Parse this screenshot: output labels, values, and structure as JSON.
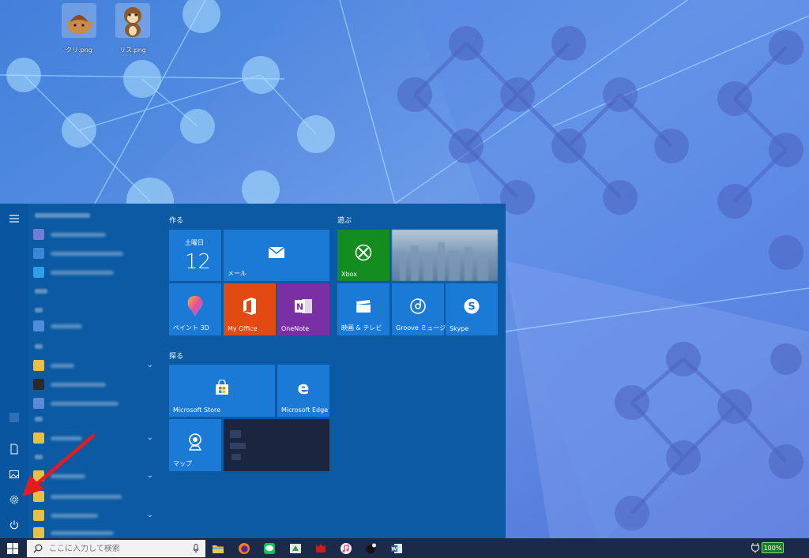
{
  "desktop": {
    "icons": [
      {
        "label": "クリ.png"
      },
      {
        "label": "リス.png"
      }
    ]
  },
  "start_menu": {
    "groups": {
      "create": "作る",
      "play": "遊ぶ",
      "explore": "探る"
    },
    "tiles": {
      "calendar_day": "土曜日",
      "calendar_date": "12",
      "mail": "メール",
      "paint3d": "ペイント 3D",
      "myoffice": "My Office",
      "onenote": "OneNote",
      "xbox": "Xbox",
      "movies": "映画 & テレビ",
      "groove": "Groove ミュージ...",
      "skype": "Skype",
      "store": "Microsoft Store",
      "edge": "Microsoft Edge",
      "maps": "マップ"
    },
    "colors": {
      "menu_bg": "#0b5aa3",
      "tile_blue": "#1a7ad6",
      "office_orange": "#e34a12",
      "onenote_purple": "#7a2fa6",
      "xbox_green": "#138d1f",
      "arrow_red": "#e41c1c"
    }
  },
  "taskbar": {
    "search_placeholder": "ここに入力して検索",
    "battery": "100%"
  }
}
